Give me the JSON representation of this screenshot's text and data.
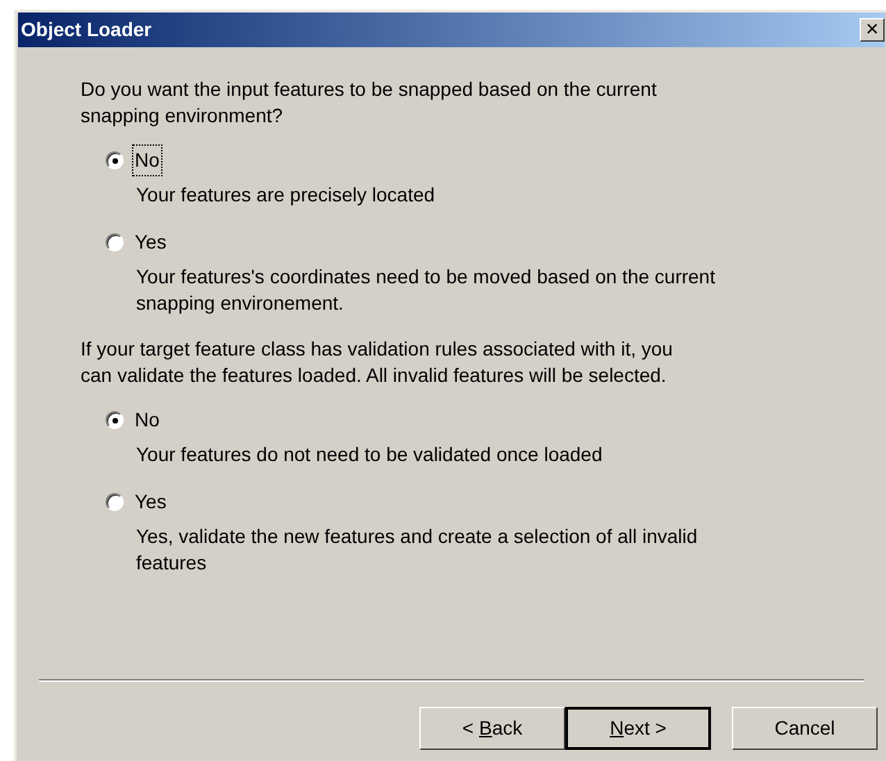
{
  "window": {
    "title": "Object Loader",
    "close": "×"
  },
  "groups": [
    {
      "question": "Do you want the input features to be snapped based on the current snapping environment?",
      "options": [
        {
          "label": "No",
          "description": "Your features are precisely located",
          "selected": true,
          "focused": true
        },
        {
          "label": "Yes",
          "description": "Your features's coordinates need to be moved based on the current snapping environement.",
          "selected": false,
          "focused": false
        }
      ]
    },
    {
      "question": "If your target feature class has validation rules associated with it, you can validate the features loaded. All invalid features will be selected.",
      "options": [
        {
          "label": "No",
          "description": "Your features do not need to be validated once loaded",
          "selected": true,
          "focused": false
        },
        {
          "label": "Yes",
          "description": "Yes, validate the new features and create a selection of all invalid features",
          "selected": false,
          "focused": false
        }
      ]
    }
  ],
  "buttons": [
    {
      "prefix": "< ",
      "accel": "B",
      "suffix": "ack",
      "default": false
    },
    {
      "accel": "N",
      "suffix": "ext >",
      "default": true
    },
    {
      "prefix": "Cancel",
      "default": false
    }
  ]
}
